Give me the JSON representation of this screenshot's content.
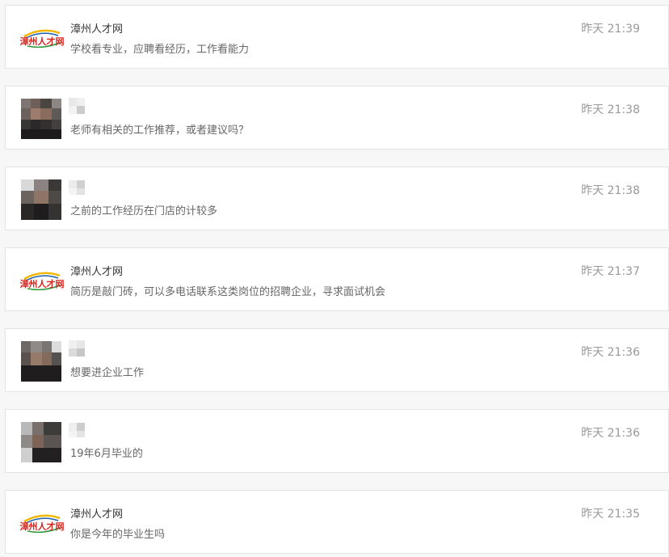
{
  "messages": [
    {
      "sender_type": "official",
      "name": "漳州人才网",
      "logo_text": "漳州人才网",
      "text": "学校看专业，应聘看经历，工作看能力",
      "time": "昨天 21:39"
    },
    {
      "sender_type": "user",
      "name": "",
      "text": "老师有相关的工作推荐，或者建议吗？",
      "time": "昨天 21:38"
    },
    {
      "sender_type": "user",
      "name": "",
      "text": "之前的工作经历在门店的计较多",
      "time": "昨天 21:38"
    },
    {
      "sender_type": "official",
      "name": "漳州人才网",
      "logo_text": "漳州人才网",
      "text": "简历是敲门砖，可以多电话联系这类岗位的招聘企业，寻求面试机会",
      "time": "昨天 21:37"
    },
    {
      "sender_type": "user",
      "name": "",
      "text": "想要进企业工作",
      "time": "昨天 21:36"
    },
    {
      "sender_type": "user",
      "name": "",
      "text": "19年6月毕业的",
      "time": "昨天 21:36"
    },
    {
      "sender_type": "official",
      "name": "漳州人才网",
      "logo_text": "漳州人才网",
      "text": "你是今年的毕业生吗",
      "time": "昨天 21:35"
    }
  ],
  "colors": {
    "logo_red": "#d7261e",
    "logo_yellow": "#f2b705",
    "logo_blue": "#1b5fae",
    "logo_green": "#2f9a3c"
  }
}
